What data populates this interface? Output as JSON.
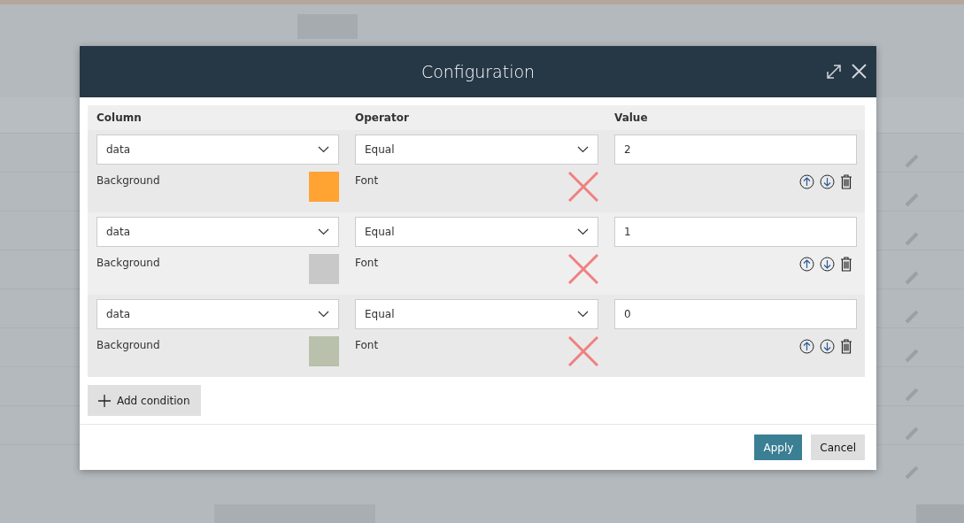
{
  "dialog": {
    "title": "Configuration",
    "columns": [
      "Column",
      "Operator",
      "Value"
    ],
    "conditions": [
      {
        "column": "data",
        "operator": "Equal",
        "value": "2",
        "background_label": "Background",
        "color": "#ffa333",
        "font_label": "Font",
        "font_colored": false
      },
      {
        "column": "data",
        "operator": "Equal",
        "value": "1",
        "background_label": "Background",
        "color": "#c8c8c9",
        "font_label": "Font",
        "font_colored": false
      },
      {
        "column": "data",
        "operator": "Equal",
        "value": "0",
        "background_label": "Background",
        "color": "#b9c0ab",
        "font_label": "Font",
        "font_colored": false
      }
    ],
    "add_button": "Add condition",
    "buttons": [
      {
        "label": "Apply",
        "kind": "primary"
      },
      {
        "label": "Cancel",
        "kind": "secondary"
      }
    ]
  }
}
